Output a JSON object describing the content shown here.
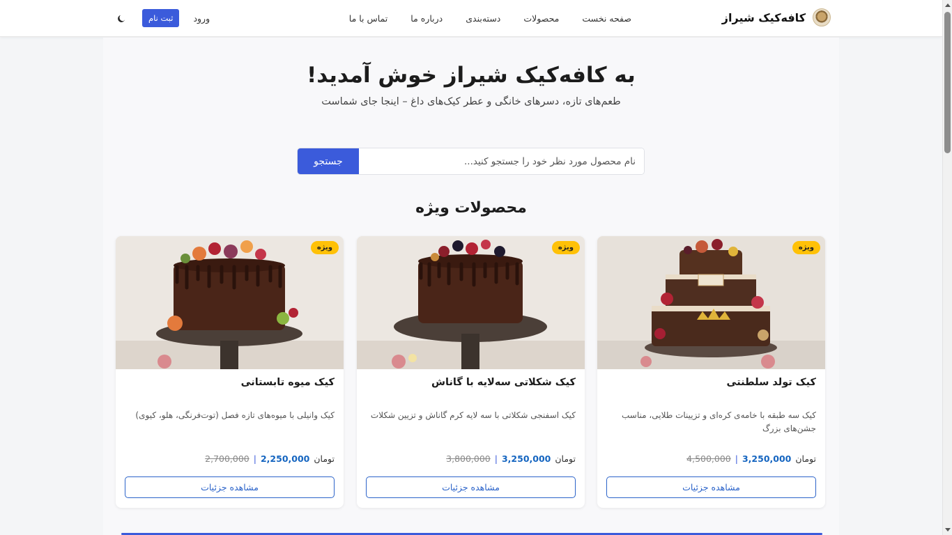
{
  "header": {
    "brand_name": "کافه‌کیک شیراز",
    "nav": [
      "صفحه نخست",
      "محصولات",
      "دسته‌بندی",
      "درباره ما",
      "تماس با ما"
    ],
    "register_label": "ثبت نام",
    "login_label": "ورود"
  },
  "hero": {
    "title": "به کافه‌کیک شیراز خوش آمدید!",
    "subtitle": "طعم‌های تازه، دسرهای خانگی و عطر کیک‌های داغ – اینجا جای شماست"
  },
  "search": {
    "placeholder": "نام محصول مورد نظر خود را جستجو کنید...",
    "button_label": "جستجو"
  },
  "featured": {
    "title": "محصولات ویژه",
    "items": [
      {
        "badge": "ویژه",
        "title": "کیک تولد سلطنتی",
        "description": "کیک سه طبقه با خامه‌ی کره‌ای و تزیینات طلایی، مناسب جشن‌های بزرگ",
        "old_price": "4,500,000",
        "new_price": "3,250,000",
        "currency": "تومان",
        "button_label": "مشاهده جزئیات",
        "image_icon": "royal-cake-image"
      },
      {
        "badge": "ویژه",
        "title": "کیک شکلاتی سه‌لایه با گاناش",
        "description": "کیک اسفنجی شکلاتی با سه لایه کرم گاناش و تزیین شکلات",
        "old_price": "3,800,000",
        "new_price": "3,250,000",
        "currency": "تومان",
        "button_label": "مشاهده جزئیات",
        "image_icon": "chocolate-cake-image"
      },
      {
        "badge": "ویژه",
        "title": "کیک میوه تابستانی",
        "description": "کیک وانیلی با میوه‌های تازه فصل (توت‌فرنگی، هلو، کیوی)",
        "old_price": "2,700,000",
        "new_price": "2,250,000",
        "currency": "تومان",
        "button_label": "مشاهده جزئیات",
        "image_icon": "fruit-cake-image"
      }
    ]
  },
  "colors": {
    "accent": "#3b5bdb",
    "badge": "#ffc107",
    "price": "#1565c0"
  }
}
